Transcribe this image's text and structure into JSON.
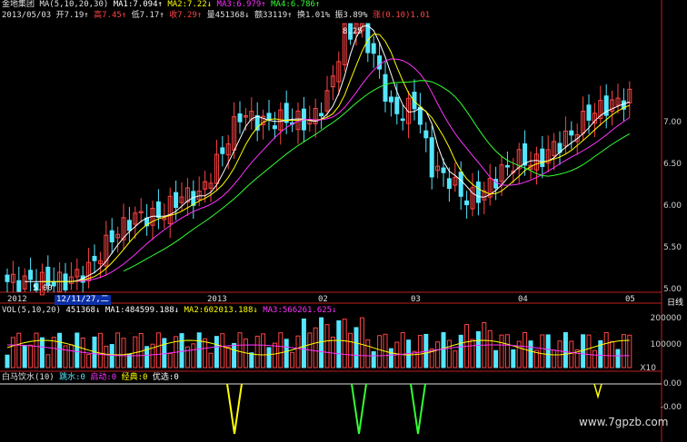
{
  "header": {
    "stock_name": "金地集团",
    "ma_params": "MA(5,10,20,30)",
    "ma1": "MA1:7.094↑",
    "ma2": "MA2:7.22↓",
    "ma3": "MA3:6.979↑",
    "ma4": "MA4:6.786↑"
  },
  "quote": {
    "date": "2013/05/03",
    "open": "开7.19↑",
    "high": "高7.45↑",
    "low": "低7.17↑",
    "close": "收7.29↑",
    "volume": "量451368↓",
    "amount": "额33119↑",
    "turnover": "换1.01%",
    "amplitude": "振3.89%",
    "change": "涨(0.10)1.01"
  },
  "price_axis": {
    "labels": [
      "7.00",
      "6.50",
      "6.00",
      "5.50",
      "5.00"
    ],
    "unit": "日线",
    "high_marker": "8.25",
    "low_marker": "5.00"
  },
  "time_axis": {
    "labels": [
      "2012",
      "12/11/27,二",
      "2013",
      "02",
      "03",
      "04",
      "05"
    ]
  },
  "volume_panel": {
    "title": "VOL(5,10,20)",
    "vol": "451368↓",
    "ma1": "MA1:484599.188↓",
    "ma2": "MA2:602013.188↓",
    "ma3": "MA3:566261.625↓",
    "axis": [
      "200000",
      "100000",
      "X10"
    ]
  },
  "indicator_panel": {
    "title": "白马饮水(10)",
    "tiaoshui": "跳水:0",
    "qidong": "启动:0",
    "jingdian": "经典:0",
    "youxuan": "优选:0",
    "axis": [
      "0.00",
      "-0.00"
    ]
  },
  "watermark": "www.7gpzb.com",
  "colors": {
    "up": "#ff4444",
    "down": "#55e6ff",
    "ma1": "#ffffff",
    "ma2": "#ffff00",
    "ma3": "#ff33ff",
    "ma4": "#33ff33",
    "frame": "#c02020"
  }
}
